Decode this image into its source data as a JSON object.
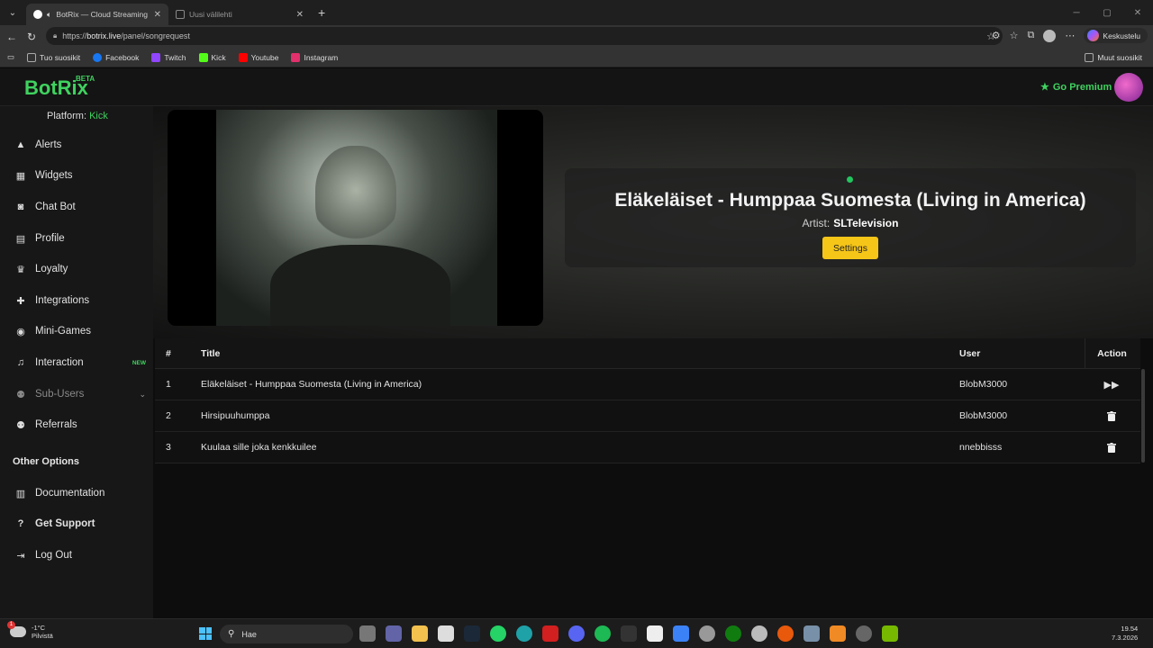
{
  "browser": {
    "tabs": [
      {
        "title": "BotRix — Cloud Streaming Bo",
        "active": true
      },
      {
        "title": "Uusi välilehti",
        "active": false
      }
    ],
    "url_scheme": "https://",
    "url_host": "botrix.live",
    "url_path": "/panel/songrequest",
    "copilot_label": "Keskustelu",
    "bookmarks": [
      {
        "label": "Tuo suosikit",
        "color": "#9aa0a6"
      },
      {
        "label": "Facebook",
        "color": "#1877f2"
      },
      {
        "label": "Twitch",
        "color": "#9146ff"
      },
      {
        "label": "Kick",
        "color": "#53fc18"
      },
      {
        "label": "Youtube",
        "color": "#ff0000"
      },
      {
        "label": "Instagram",
        "color": "#e1306c"
      }
    ],
    "bookmarks_other": "Muut suosikit"
  },
  "app": {
    "logo": "BotRix",
    "logo_badge": "BETA",
    "premium_label": "Go Premium",
    "platform_label": "Platform:",
    "platform_value": "Kick",
    "sidebar": {
      "items": [
        {
          "label": "Alerts",
          "icon": "warning-icon"
        },
        {
          "label": "Widgets",
          "icon": "grid-icon"
        },
        {
          "label": "Chat Bot",
          "icon": "robot-icon"
        },
        {
          "label": "Profile",
          "icon": "id-card-icon"
        },
        {
          "label": "Loyalty",
          "icon": "trophy-icon"
        },
        {
          "label": "Integrations",
          "icon": "puzzle-icon"
        },
        {
          "label": "Mini-Games",
          "icon": "gamepad-icon"
        },
        {
          "label": "Interaction",
          "icon": "music-icon",
          "badge": "NEW"
        },
        {
          "label": "Sub-Users",
          "icon": "users-icon"
        },
        {
          "label": "Referrals",
          "icon": "users-icon"
        }
      ],
      "other_heading": "Other Options",
      "other_items": [
        {
          "label": "Documentation",
          "icon": "book-icon"
        },
        {
          "label": "Get Support",
          "icon": "question-icon"
        },
        {
          "label": "Log Out",
          "icon": "logout-icon"
        }
      ]
    },
    "now_playing": {
      "title": "Eläkeläiset - Humppaa Suomesta (Living in America)",
      "artist_label": "Artist:",
      "artist": "SLTelevision",
      "settings_label": "Settings"
    },
    "queue": {
      "headers": {
        "num": "#",
        "title": "Title",
        "user": "User",
        "action": "Action"
      },
      "rows": [
        {
          "num": "1",
          "title": "Eläkeläiset - Humppaa Suomesta (Living in America)",
          "user": "BlobM3000",
          "action": "skip-icon"
        },
        {
          "num": "2",
          "title": "Hirsipuuhumppa",
          "user": "BlobM3000",
          "action": "trash-icon"
        },
        {
          "num": "3",
          "title": "Kuulaa sille joka kenkkuilee",
          "user": "nnebbisss",
          "action": "trash-icon"
        }
      ]
    }
  },
  "taskbar": {
    "weather_temp": "-1°C",
    "weather_desc": "Pilvistä",
    "weather_badge": "1",
    "search_placeholder": "Hae",
    "time": "19.54",
    "date": "7.3.2026"
  }
}
